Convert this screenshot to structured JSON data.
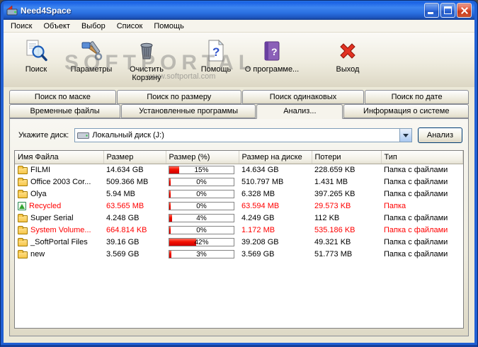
{
  "window": {
    "title": "Need4Space"
  },
  "menu": {
    "items": [
      "Поиск",
      "Объект",
      "Выбор",
      "Список",
      "Помощь"
    ]
  },
  "toolbar": {
    "buttons": [
      {
        "label": "Поиск",
        "icon": "search-icon"
      },
      {
        "label": "Параметры",
        "icon": "settings-icon"
      },
      {
        "label": "Очистить Корзину",
        "icon": "trash-icon"
      },
      {
        "label": "Помощь",
        "icon": "help-icon"
      },
      {
        "label": "О программе...",
        "icon": "about-icon"
      },
      {
        "label": "Выход",
        "icon": "exit-icon"
      }
    ]
  },
  "watermark": {
    "line1": "SOFTPORTAL",
    "line2": "www.softportal.com"
  },
  "tabs": {
    "row1": [
      "Поиск по маске",
      "Поиск по размеру",
      "Поиск одинаковых",
      "Поиск по дате"
    ],
    "row2": [
      "Временные файлы",
      "Установленные программы",
      "Анализ...",
      "Информация о системе"
    ],
    "active": "Анализ..."
  },
  "panel": {
    "disk_label": "Укажите диск:",
    "disk_value": "Локальный диск (J:)",
    "analyze_button": "Анализ"
  },
  "table": {
    "columns": [
      "Имя Файла",
      "Размер",
      "Размер (%)",
      "Размер на диске",
      "Потери",
      "Тип"
    ],
    "rows": [
      {
        "name": "FILMI",
        "size": "14.634 GB",
        "percent": 15,
        "percent_label": "15%",
        "disk_size": "14.634 GB",
        "loss": "228.659 KB",
        "type": "Папка с файлами",
        "red": false,
        "icon": "folder"
      },
      {
        "name": "Office 2003 Cor...",
        "size": "509.366 MB",
        "percent": 0,
        "percent_label": "0%",
        "disk_size": "510.797 MB",
        "loss": "1.431 MB",
        "type": "Папка с файлами",
        "red": false,
        "icon": "folder"
      },
      {
        "name": "Olya",
        "size": "5.94 MB",
        "percent": 0,
        "percent_label": "0%",
        "disk_size": "6.328 MB",
        "loss": "397.265 KB",
        "type": "Папка с файлами",
        "red": false,
        "icon": "folder"
      },
      {
        "name": "Recycled",
        "size": "63.565 MB",
        "percent": 0,
        "percent_label": "0%",
        "disk_size": "63.594 MB",
        "loss": "29.573 KB",
        "type": "Папка",
        "red": true,
        "icon": "recycle"
      },
      {
        "name": "Super Serial",
        "size": "4.248 GB",
        "percent": 4,
        "percent_label": "4%",
        "disk_size": "4.249 GB",
        "loss": "112 KB",
        "type": "Папка с файлами",
        "red": false,
        "icon": "folder"
      },
      {
        "name": "System Volume...",
        "size": "664.814 KB",
        "percent": 0,
        "percent_label": "0%",
        "disk_size": "1.172 MB",
        "loss": "535.186 KB",
        "type": "Папка с файлами",
        "red": true,
        "icon": "folder"
      },
      {
        "name": "_SoftPortal Files",
        "size": "39.16 GB",
        "percent": 42,
        "percent_label": "42%",
        "disk_size": "39.208 GB",
        "loss": "49.321 KB",
        "type": "Папка с файлами",
        "red": false,
        "icon": "folder"
      },
      {
        "name": "new",
        "size": "3.569 GB",
        "percent": 3,
        "percent_label": "3%",
        "disk_size": "3.569 GB",
        "loss": "51.773 MB",
        "type": "Папка с файлами",
        "red": false,
        "icon": "folder"
      }
    ]
  }
}
